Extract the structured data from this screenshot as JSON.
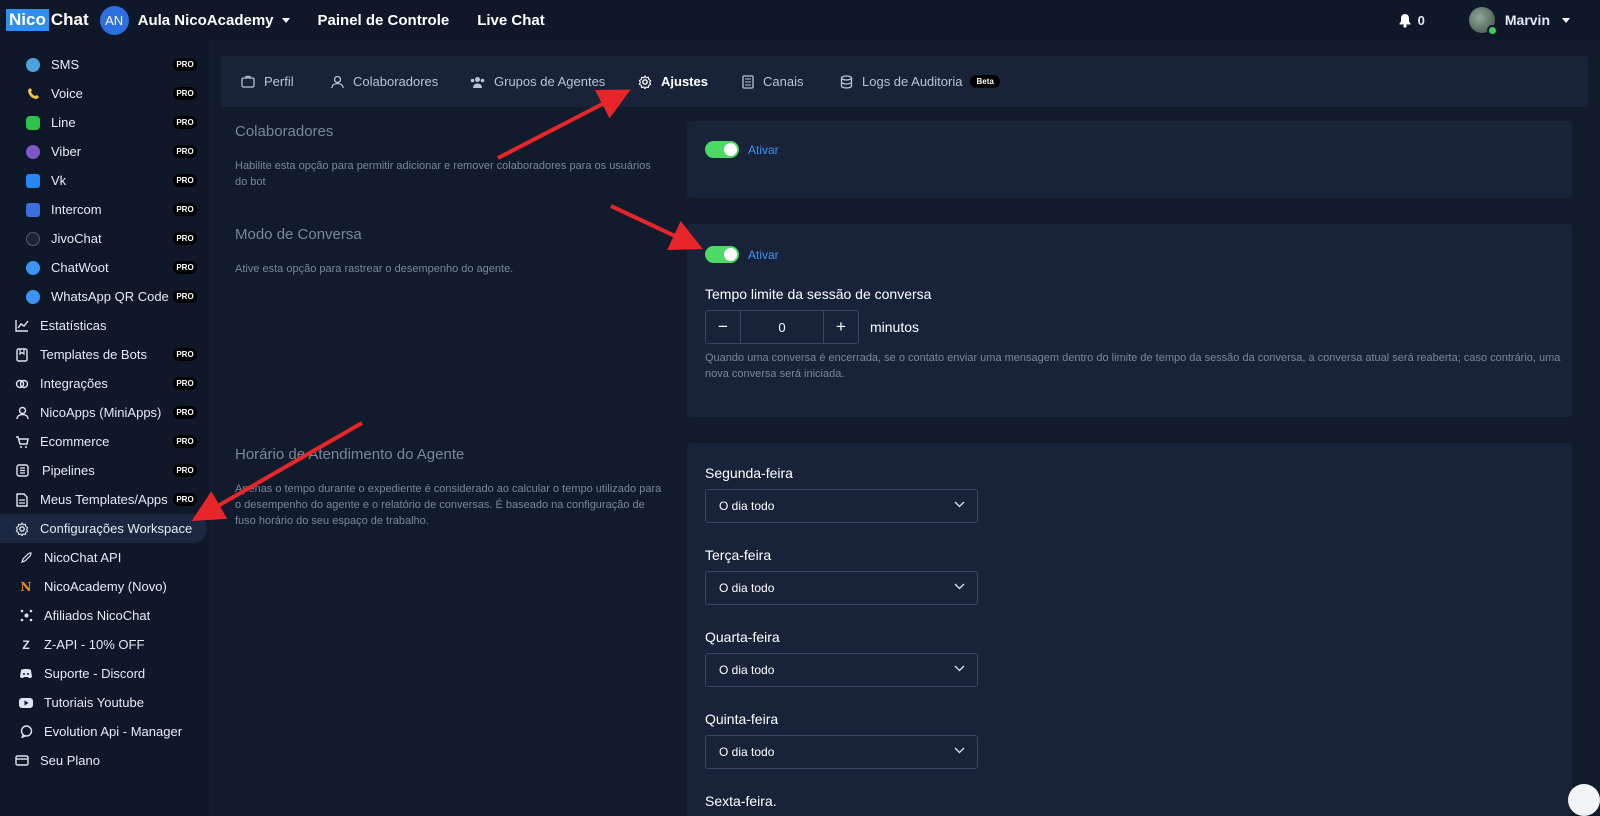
{
  "topbar": {
    "logo_part1": "Nico",
    "logo_part2": "Chat",
    "workspace_initials": "AN",
    "workspace_name": "Aula NicoAcademy",
    "nav": [
      "Painel de Controle",
      "Live Chat"
    ],
    "notifications_count": "0",
    "user_name": "Marvin"
  },
  "sidebar": {
    "pro_badge": "PRO",
    "items": [
      {
        "label": "SMS",
        "pro": true
      },
      {
        "label": "Voice",
        "pro": true
      },
      {
        "label": "Line",
        "pro": true
      },
      {
        "label": "Viber",
        "pro": true
      },
      {
        "label": "Vk",
        "pro": true
      },
      {
        "label": "Intercom",
        "pro": true
      },
      {
        "label": "JivoChat",
        "pro": true
      },
      {
        "label": "ChatWoot",
        "pro": true
      },
      {
        "label": "WhatsApp QR Code",
        "pro": true
      },
      {
        "label": "Estatísticas",
        "pro": false
      },
      {
        "label": "Templates de Bots",
        "pro": true
      },
      {
        "label": "Integrações",
        "pro": true
      },
      {
        "label": "NicoApps (MiniApps)",
        "pro": true
      },
      {
        "label": "Ecommerce",
        "pro": true
      },
      {
        "label": "Pipelines",
        "pro": true
      },
      {
        "label": "Meus Templates/Apps",
        "pro": true
      },
      {
        "label": "Configurações Workspace",
        "pro": false,
        "active": true
      },
      {
        "label": "NicoChat API",
        "pro": false
      },
      {
        "label": "NicoAcademy (Novo)",
        "pro": false
      },
      {
        "label": "Afiliados NicoChat",
        "pro": false
      },
      {
        "label": "Z-API - 10% OFF",
        "pro": false
      },
      {
        "label": "Suporte - Discord",
        "pro": false
      },
      {
        "label": "Tutoriais Youtube",
        "pro": false
      },
      {
        "label": "Evolution Api - Manager",
        "pro": false
      },
      {
        "label": "Seu Plano",
        "pro": false
      }
    ]
  },
  "tabs": {
    "items": [
      "Perfil",
      "Colaboradores",
      "Grupos de Agentes",
      "Ajustes",
      "Canais",
      "Logs de Auditoria"
    ],
    "active": "Ajustes",
    "beta_badge": "Beta"
  },
  "sections": {
    "collaborators": {
      "title": "Colaboradores",
      "description": "Habilite esta opção para permitir adicionar e remover colaboradores para os usuários do bot",
      "toggle_label": "Ativar",
      "enabled": true
    },
    "conversation_mode": {
      "title": "Modo de Conversa",
      "description": "Ative esta opção para rastrear o desempenho do agente.",
      "toggle_label": "Ativar",
      "enabled": true,
      "timeout_label": "Tempo limite da sessão de conversa",
      "timeout_value": "0",
      "timeout_unit": "minutos",
      "minus": "−",
      "plus": "+",
      "hint": "Quando uma conversa é encerrada, se o contato enviar uma mensagem dentro do limite de tempo da sessão da conversa, a conversa atual será reaberta; caso contrário, uma nova conversa será iniciada."
    },
    "agent_hours": {
      "title": "Horário de Atendimento do Agente",
      "description": "Apenas o tempo durante o expediente é considerado ao calcular o tempo utilizado para o desempenho do agente e o relatório de conversas. É baseado na configuração de fuso horário do seu espaço de trabalho.",
      "days": [
        {
          "label": "Segunda-feira",
          "value": "O dia todo"
        },
        {
          "label": "Terça-feira",
          "value": "O dia todo"
        },
        {
          "label": "Quarta-feira",
          "value": "O dia todo"
        },
        {
          "label": "Quinta-feira",
          "value": "O dia todo"
        },
        {
          "label": "Sexta-feira.",
          "value": ""
        }
      ]
    }
  },
  "colors": {
    "background": "#111b2c",
    "panel": "#18233a",
    "accent": "#3b94f2",
    "toggle_on": "#4cd964",
    "annotation_arrow": "#e8262a"
  }
}
